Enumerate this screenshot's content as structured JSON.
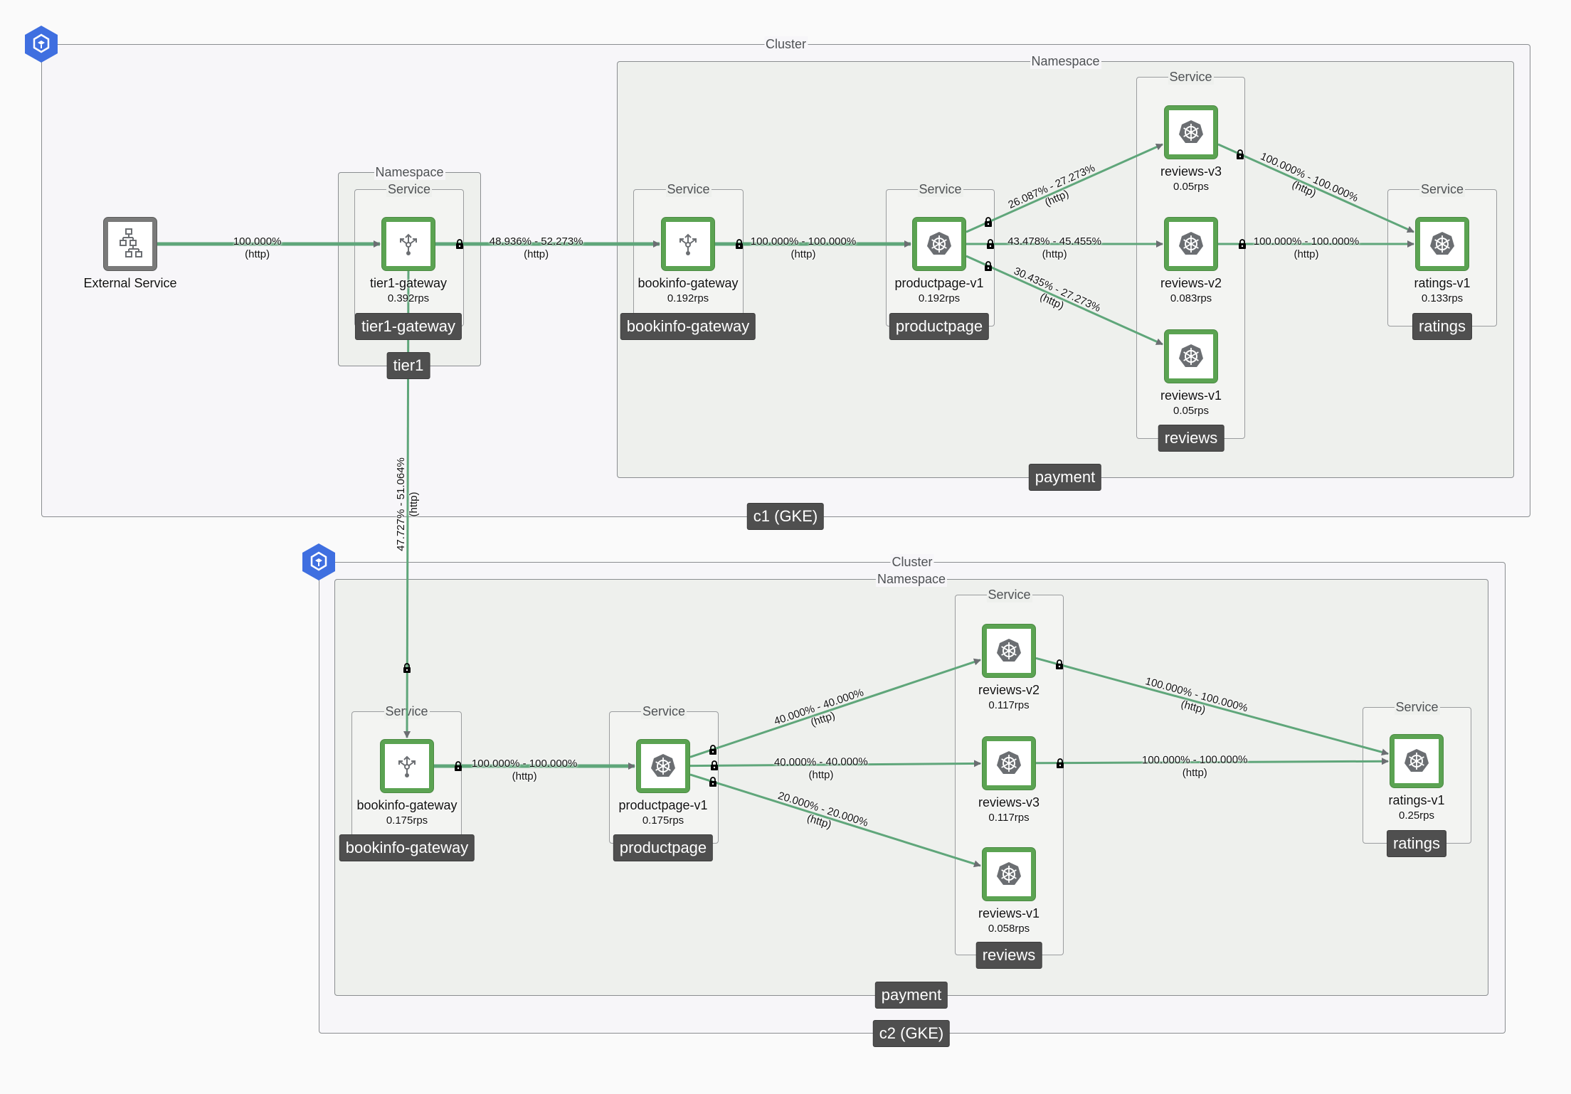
{
  "colors": {
    "edge": "#5fa67a",
    "node_border": "#5ba352",
    "tag_bg": "#4f4f4f",
    "cluster_icon": "#3f6fe0"
  },
  "labels": {
    "cluster": "Cluster",
    "namespace": "Namespace",
    "service": "Service"
  },
  "clusters": [
    {
      "id": "c1",
      "name": "c1 (GKE)",
      "icon": "cluster-icon"
    },
    {
      "id": "c2",
      "name": "c2 (GKE)",
      "icon": "cluster-icon"
    }
  ],
  "namespaces": {
    "c1_tier1": "tier1",
    "c1_payment": "payment",
    "c2_payment": "payment"
  },
  "services": {
    "c1_tier1_gateway": "tier1-gateway",
    "c1_bookinfo_gateway": "bookinfo-gateway",
    "c1_productpage": "productpage",
    "c1_reviews": "reviews",
    "c1_ratings": "ratings",
    "c2_bookinfo_gateway": "bookinfo-gateway",
    "c2_productpage": "productpage",
    "c2_reviews": "reviews",
    "c2_ratings": "ratings"
  },
  "nodes": {
    "external": {
      "label": "External Service",
      "icon": "external-service-icon"
    },
    "c1_tier1_gw": {
      "label": "tier1-gateway",
      "rps": "0.392rps",
      "icon": "gateway-icon"
    },
    "c1_bookinfo_gw": {
      "label": "bookinfo-gateway",
      "rps": "0.192rps",
      "icon": "gateway-icon"
    },
    "c1_productpage": {
      "label": "productpage-v1",
      "rps": "0.192rps",
      "icon": "kubernetes-icon"
    },
    "c1_reviews_v3": {
      "label": "reviews-v3",
      "rps": "0.05rps",
      "icon": "kubernetes-icon"
    },
    "c1_reviews_v2": {
      "label": "reviews-v2",
      "rps": "0.083rps",
      "icon": "kubernetes-icon"
    },
    "c1_reviews_v1": {
      "label": "reviews-v1",
      "rps": "0.05rps",
      "icon": "kubernetes-icon"
    },
    "c1_ratings": {
      "label": "ratings-v1",
      "rps": "0.133rps",
      "icon": "kubernetes-icon"
    },
    "c2_bookinfo_gw": {
      "label": "bookinfo-gateway",
      "rps": "0.175rps",
      "icon": "gateway-icon"
    },
    "c2_productpage": {
      "label": "productpage-v1",
      "rps": "0.175rps",
      "icon": "kubernetes-icon"
    },
    "c2_reviews_v2": {
      "label": "reviews-v2",
      "rps": "0.117rps",
      "icon": "kubernetes-icon"
    },
    "c2_reviews_v3": {
      "label": "reviews-v3",
      "rps": "0.117rps",
      "icon": "kubernetes-icon"
    },
    "c2_reviews_v1": {
      "label": "reviews-v1",
      "rps": "0.058rps",
      "icon": "kubernetes-icon"
    },
    "c2_ratings": {
      "label": "ratings-v1",
      "rps": "0.25rps",
      "icon": "kubernetes-icon"
    }
  },
  "edges": [
    {
      "from": "external",
      "to": "c1_tier1_gw",
      "pct": "100.000%",
      "proto": "(http)",
      "mtls": false
    },
    {
      "from": "c1_tier1_gw",
      "to": "c1_bookinfo_gw",
      "pct": "48.936% - 52.273%",
      "proto": "(http)",
      "mtls": true
    },
    {
      "from": "c1_tier1_gw",
      "to": "c2_bookinfo_gw",
      "pct": "47.727% - 51.064%",
      "proto": "(http)",
      "mtls": true
    },
    {
      "from": "c1_bookinfo_gw",
      "to": "c1_productpage",
      "pct": "100.000% - 100.000%",
      "proto": "(http)",
      "mtls": true
    },
    {
      "from": "c1_productpage",
      "to": "c1_reviews_v3",
      "pct": "26.087% - 27.273%",
      "proto": "(http)",
      "mtls": true
    },
    {
      "from": "c1_productpage",
      "to": "c1_reviews_v2",
      "pct": "43.478% - 45.455%",
      "proto": "(http)",
      "mtls": true
    },
    {
      "from": "c1_productpage",
      "to": "c1_reviews_v1",
      "pct": "30.435% - 27.273%",
      "proto": "(http)",
      "mtls": true
    },
    {
      "from": "c1_reviews_v3",
      "to": "c1_ratings",
      "pct": "100.000% - 100.000%",
      "proto": "(http)",
      "mtls": true
    },
    {
      "from": "c1_reviews_v2",
      "to": "c1_ratings",
      "pct": "100.000% - 100.000%",
      "proto": "(http)",
      "mtls": true
    },
    {
      "from": "c2_bookinfo_gw",
      "to": "c2_productpage",
      "pct": "100.000% - 100.000%",
      "proto": "(http)",
      "mtls": true
    },
    {
      "from": "c2_productpage",
      "to": "c2_reviews_v2",
      "pct": "40.000% - 40.000%",
      "proto": "(http)",
      "mtls": true
    },
    {
      "from": "c2_productpage",
      "to": "c2_reviews_v3",
      "pct": "40.000% - 40.000%",
      "proto": "(http)",
      "mtls": true
    },
    {
      "from": "c2_productpage",
      "to": "c2_reviews_v1",
      "pct": "20.000% - 20.000%",
      "proto": "(http)",
      "mtls": true
    },
    {
      "from": "c2_reviews_v2",
      "to": "c2_ratings",
      "pct": "100.000% - 100.000%",
      "proto": "(http)",
      "mtls": true
    },
    {
      "from": "c2_reviews_v3",
      "to": "c2_ratings",
      "pct": "100.000% - 100.000%",
      "proto": "(http)",
      "mtls": true
    }
  ]
}
